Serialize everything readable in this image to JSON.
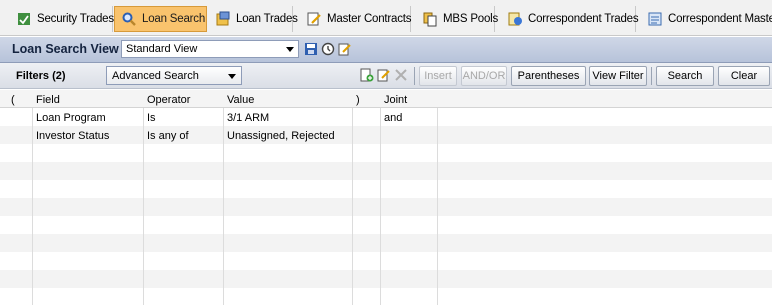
{
  "tabs": [
    {
      "label": "Security Trades",
      "icon": "security-trades-icon"
    },
    {
      "label": "Loan Search",
      "icon": "search-icon",
      "active": true
    },
    {
      "label": "Loan Trades",
      "icon": "loan-trades-icon"
    },
    {
      "label": "Master Contracts",
      "icon": "master-contracts-icon"
    },
    {
      "label": "MBS Pools",
      "icon": "mbs-pools-icon"
    },
    {
      "label": "Correspondent Trades",
      "icon": "correspondent-trades-icon"
    },
    {
      "label": "Correspondent Masters",
      "icon": "correspondent-masters-icon"
    }
  ],
  "view": {
    "title": "Loan Search View",
    "selected": "Standard View",
    "icons": [
      "save-icon",
      "reset-icon",
      "edit-icon"
    ]
  },
  "filters": {
    "label": "Filters (2)",
    "mode": "Advanced Search",
    "buttons": {
      "insert": "Insert",
      "and_or": "AND/OR",
      "parentheses": "Parentheses",
      "view_filter": "View Filter",
      "search": "Search",
      "clear": "Clear"
    }
  },
  "grid": {
    "columns": [
      "(",
      "Field",
      "Operator",
      "Value",
      ")",
      "Joint"
    ],
    "rows": [
      {
        "open": "",
        "field": "Loan Program",
        "operator": "Is",
        "value": "3/1 ARM",
        "close": "",
        "joint": "and"
      },
      {
        "open": "",
        "field": "Investor Status",
        "operator": "Is any of",
        "value": "Unassigned, Rejected",
        "close": "",
        "joint": ""
      }
    ]
  },
  "colors": {
    "active_tab": "#f9c36d",
    "view_bar": "#b7c3da",
    "title_text": "#14233f"
  }
}
